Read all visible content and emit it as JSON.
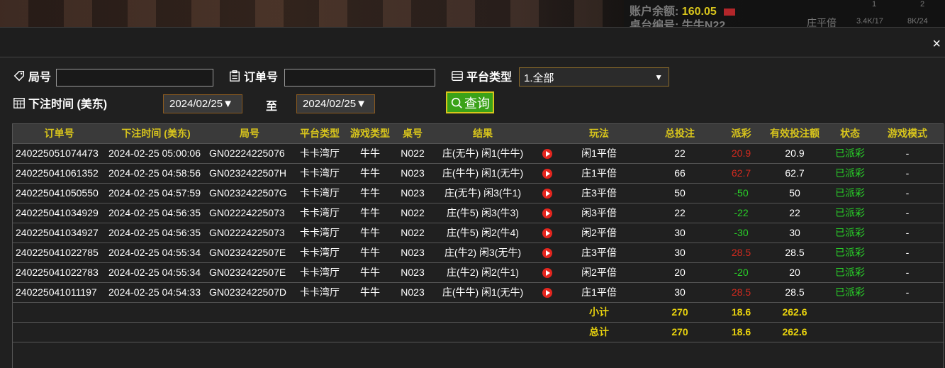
{
  "topbar": {
    "balance_label": "账户余额:",
    "balance_value": "160.05",
    "table_label": "桌台编号:",
    "table_value": "牛牛N22",
    "mini_cols": [
      "1",
      "2"
    ],
    "mini_label": "庄平倍",
    "mini_vals": [
      "3.4K/17",
      "8K/24"
    ]
  },
  "modal": {
    "close_label": "×"
  },
  "filters": {
    "round_label": "局号",
    "round_value": "",
    "order_label": "订单号",
    "order_value": "",
    "platform_label": "平台类型",
    "platform_selected": "1.全部",
    "time_label": "下注时间 (美东)",
    "date_from": "2024/02/25",
    "to_label": "至",
    "date_to": "2024/02/25",
    "query_label": "查询"
  },
  "table": {
    "headers": [
      "订单号",
      "下注时间 (美东)",
      "局号",
      "平台类型",
      "游戏类型",
      "桌号",
      "结果",
      "",
      "玩法",
      "总投注",
      "派彩",
      "有效投注额",
      "状态",
      "游戏模式"
    ],
    "rows": [
      {
        "order": "240225051074473",
        "time": "2024-02-25 05:00:06",
        "round": "GN02224225076",
        "platform": "卡卡湾厅",
        "game": "牛牛",
        "table": "N022",
        "result": "庄(无牛) 闲1(牛牛)",
        "bet": "闲1平倍",
        "total": "22",
        "payout": "20.9",
        "payout_color": "red",
        "valid": "20.9",
        "status": "已派彩",
        "mode": "-"
      },
      {
        "order": "240225041061352",
        "time": "2024-02-25 04:58:56",
        "round": "GN0232422507H",
        "platform": "卡卡湾厅",
        "game": "牛牛",
        "table": "N023",
        "result": "庄(牛牛) 闲1(无牛)",
        "bet": "庄1平倍",
        "total": "66",
        "payout": "62.7",
        "payout_color": "red",
        "valid": "62.7",
        "status": "已派彩",
        "mode": "-"
      },
      {
        "order": "240225041050550",
        "time": "2024-02-25 04:57:59",
        "round": "GN0232422507G",
        "platform": "卡卡湾厅",
        "game": "牛牛",
        "table": "N023",
        "result": "庄(无牛) 闲3(牛1)",
        "bet": "庄3平倍",
        "total": "50",
        "payout": "-50",
        "payout_color": "green",
        "valid": "50",
        "status": "已派彩",
        "mode": "-"
      },
      {
        "order": "240225041034929",
        "time": "2024-02-25 04:56:35",
        "round": "GN02224225073",
        "platform": "卡卡湾厅",
        "game": "牛牛",
        "table": "N022",
        "result": "庄(牛5) 闲3(牛3)",
        "bet": "闲3平倍",
        "total": "22",
        "payout": "-22",
        "payout_color": "green",
        "valid": "22",
        "status": "已派彩",
        "mode": "-"
      },
      {
        "order": "240225041034927",
        "time": "2024-02-25 04:56:35",
        "round": "GN02224225073",
        "platform": "卡卡湾厅",
        "game": "牛牛",
        "table": "N022",
        "result": "庄(牛5) 闲2(牛4)",
        "bet": "闲2平倍",
        "total": "30",
        "payout": "-30",
        "payout_color": "green",
        "valid": "30",
        "status": "已派彩",
        "mode": "-"
      },
      {
        "order": "240225041022785",
        "time": "2024-02-25 04:55:34",
        "round": "GN0232422507E",
        "platform": "卡卡湾厅",
        "game": "牛牛",
        "table": "N023",
        "result": "庄(牛2) 闲3(无牛)",
        "bet": "庄3平倍",
        "total": "30",
        "payout": "28.5",
        "payout_color": "red",
        "valid": "28.5",
        "status": "已派彩",
        "mode": "-"
      },
      {
        "order": "240225041022783",
        "time": "2024-02-25 04:55:34",
        "round": "GN0232422507E",
        "platform": "卡卡湾厅",
        "game": "牛牛",
        "table": "N023",
        "result": "庄(牛2) 闲2(牛1)",
        "bet": "闲2平倍",
        "total": "20",
        "payout": "-20",
        "payout_color": "green",
        "valid": "20",
        "status": "已派彩",
        "mode": "-"
      },
      {
        "order": "240225041011197",
        "time": "2024-02-25 04:54:33",
        "round": "GN0232422507D",
        "platform": "卡卡湾厅",
        "game": "牛牛",
        "table": "N023",
        "result": "庄(牛牛) 闲1(无牛)",
        "bet": "庄1平倍",
        "total": "30",
        "payout": "28.5",
        "payout_color": "red",
        "valid": "28.5",
        "status": "已派彩",
        "mode": "-"
      }
    ],
    "subtotal": {
      "label": "小计",
      "total": "270",
      "payout": "18.6",
      "valid": "262.6"
    },
    "grandtotal": {
      "label": "总计",
      "total": "270",
      "payout": "18.6",
      "valid": "262.6"
    }
  }
}
